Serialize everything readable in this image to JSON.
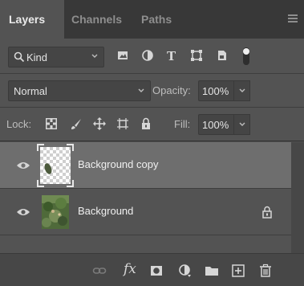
{
  "tabs": [
    {
      "label": "Layers",
      "active": true
    },
    {
      "label": "Channels",
      "active": false
    },
    {
      "label": "Paths",
      "active": false
    }
  ],
  "filter": {
    "kind_label": "Kind",
    "icons": [
      "image-filter-icon",
      "adjustment-filter-icon",
      "type-filter-icon",
      "shape-filter-icon",
      "smart-object-filter-icon",
      "filter-toggle-icon"
    ]
  },
  "blend": {
    "mode": "Normal",
    "opacity_label": "Opacity:",
    "opacity_value": "100%"
  },
  "lock": {
    "label": "Lock:",
    "icons": [
      "lock-transparent-pixels-icon",
      "lock-image-pixels-icon",
      "lock-position-icon",
      "lock-artboard-icon",
      "lock-all-icon"
    ],
    "fill_label": "Fill:",
    "fill_value": "100%"
  },
  "layers": [
    {
      "name": "Background copy",
      "selected": true,
      "visible": true,
      "locked": false
    },
    {
      "name": "Background",
      "selected": false,
      "visible": true,
      "locked": true
    }
  ],
  "bottom_toolbar": {
    "fx_label": "fx",
    "icons": [
      "link-layers-icon",
      "layer-style-icon",
      "add-mask-icon",
      "new-adjustment-layer-icon",
      "new-group-icon",
      "new-layer-icon",
      "delete-layer-icon"
    ]
  },
  "colors": {
    "panel_bg": "#535353",
    "tab_bar_bg": "#383838",
    "selected_layer_bg": "#6e6e6e",
    "text": "#cfcfcf"
  }
}
